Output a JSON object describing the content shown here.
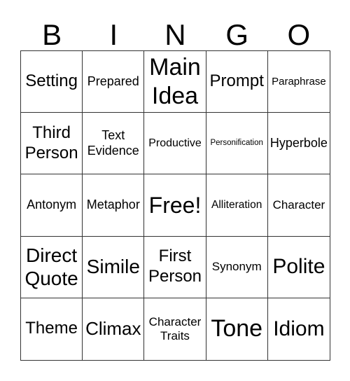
{
  "header": [
    "B",
    "I",
    "N",
    "G",
    "O"
  ],
  "cells": [
    "Setting",
    "Prepared",
    "Main\nIdea",
    "Prompt",
    "Paraphrase",
    "Third\nPerson",
    "Text\nEvidence",
    "Productive",
    "Personification",
    "Hyperbole",
    "Antonym",
    "Metaphor",
    "Free!",
    "Alliteration",
    "Character",
    "Direct\nQuote",
    "Simile",
    "First\nPerson",
    "Synonym",
    "Polite",
    "Theme",
    "Climax",
    "Character\nTraits",
    "Tone",
    "Idiom"
  ]
}
